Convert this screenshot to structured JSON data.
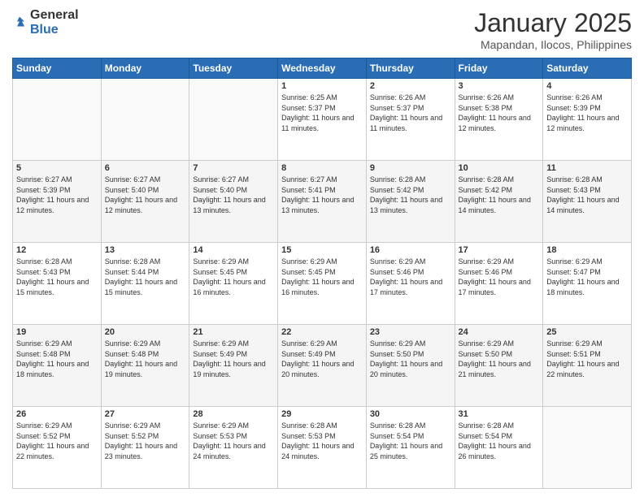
{
  "logo": {
    "general": "General",
    "blue": "Blue"
  },
  "header": {
    "month": "January 2025",
    "location": "Mapandan, Ilocos, Philippines"
  },
  "weekdays": [
    "Sunday",
    "Monday",
    "Tuesday",
    "Wednesday",
    "Thursday",
    "Friday",
    "Saturday"
  ],
  "weeks": [
    [
      {
        "day": "",
        "sunrise": "",
        "sunset": "",
        "daylight": ""
      },
      {
        "day": "",
        "sunrise": "",
        "sunset": "",
        "daylight": ""
      },
      {
        "day": "",
        "sunrise": "",
        "sunset": "",
        "daylight": ""
      },
      {
        "day": "1",
        "sunrise": "Sunrise: 6:25 AM",
        "sunset": "Sunset: 5:37 PM",
        "daylight": "Daylight: 11 hours and 11 minutes."
      },
      {
        "day": "2",
        "sunrise": "Sunrise: 6:26 AM",
        "sunset": "Sunset: 5:37 PM",
        "daylight": "Daylight: 11 hours and 11 minutes."
      },
      {
        "day": "3",
        "sunrise": "Sunrise: 6:26 AM",
        "sunset": "Sunset: 5:38 PM",
        "daylight": "Daylight: 11 hours and 12 minutes."
      },
      {
        "day": "4",
        "sunrise": "Sunrise: 6:26 AM",
        "sunset": "Sunset: 5:39 PM",
        "daylight": "Daylight: 11 hours and 12 minutes."
      }
    ],
    [
      {
        "day": "5",
        "sunrise": "Sunrise: 6:27 AM",
        "sunset": "Sunset: 5:39 PM",
        "daylight": "Daylight: 11 hours and 12 minutes."
      },
      {
        "day": "6",
        "sunrise": "Sunrise: 6:27 AM",
        "sunset": "Sunset: 5:40 PM",
        "daylight": "Daylight: 11 hours and 12 minutes."
      },
      {
        "day": "7",
        "sunrise": "Sunrise: 6:27 AM",
        "sunset": "Sunset: 5:40 PM",
        "daylight": "Daylight: 11 hours and 13 minutes."
      },
      {
        "day": "8",
        "sunrise": "Sunrise: 6:27 AM",
        "sunset": "Sunset: 5:41 PM",
        "daylight": "Daylight: 11 hours and 13 minutes."
      },
      {
        "day": "9",
        "sunrise": "Sunrise: 6:28 AM",
        "sunset": "Sunset: 5:42 PM",
        "daylight": "Daylight: 11 hours and 13 minutes."
      },
      {
        "day": "10",
        "sunrise": "Sunrise: 6:28 AM",
        "sunset": "Sunset: 5:42 PM",
        "daylight": "Daylight: 11 hours and 14 minutes."
      },
      {
        "day": "11",
        "sunrise": "Sunrise: 6:28 AM",
        "sunset": "Sunset: 5:43 PM",
        "daylight": "Daylight: 11 hours and 14 minutes."
      }
    ],
    [
      {
        "day": "12",
        "sunrise": "Sunrise: 6:28 AM",
        "sunset": "Sunset: 5:43 PM",
        "daylight": "Daylight: 11 hours and 15 minutes."
      },
      {
        "day": "13",
        "sunrise": "Sunrise: 6:28 AM",
        "sunset": "Sunset: 5:44 PM",
        "daylight": "Daylight: 11 hours and 15 minutes."
      },
      {
        "day": "14",
        "sunrise": "Sunrise: 6:29 AM",
        "sunset": "Sunset: 5:45 PM",
        "daylight": "Daylight: 11 hours and 16 minutes."
      },
      {
        "day": "15",
        "sunrise": "Sunrise: 6:29 AM",
        "sunset": "Sunset: 5:45 PM",
        "daylight": "Daylight: 11 hours and 16 minutes."
      },
      {
        "day": "16",
        "sunrise": "Sunrise: 6:29 AM",
        "sunset": "Sunset: 5:46 PM",
        "daylight": "Daylight: 11 hours and 17 minutes."
      },
      {
        "day": "17",
        "sunrise": "Sunrise: 6:29 AM",
        "sunset": "Sunset: 5:46 PM",
        "daylight": "Daylight: 11 hours and 17 minutes."
      },
      {
        "day": "18",
        "sunrise": "Sunrise: 6:29 AM",
        "sunset": "Sunset: 5:47 PM",
        "daylight": "Daylight: 11 hours and 18 minutes."
      }
    ],
    [
      {
        "day": "19",
        "sunrise": "Sunrise: 6:29 AM",
        "sunset": "Sunset: 5:48 PM",
        "daylight": "Daylight: 11 hours and 18 minutes."
      },
      {
        "day": "20",
        "sunrise": "Sunrise: 6:29 AM",
        "sunset": "Sunset: 5:48 PM",
        "daylight": "Daylight: 11 hours and 19 minutes."
      },
      {
        "day": "21",
        "sunrise": "Sunrise: 6:29 AM",
        "sunset": "Sunset: 5:49 PM",
        "daylight": "Daylight: 11 hours and 19 minutes."
      },
      {
        "day": "22",
        "sunrise": "Sunrise: 6:29 AM",
        "sunset": "Sunset: 5:49 PM",
        "daylight": "Daylight: 11 hours and 20 minutes."
      },
      {
        "day": "23",
        "sunrise": "Sunrise: 6:29 AM",
        "sunset": "Sunset: 5:50 PM",
        "daylight": "Daylight: 11 hours and 20 minutes."
      },
      {
        "day": "24",
        "sunrise": "Sunrise: 6:29 AM",
        "sunset": "Sunset: 5:50 PM",
        "daylight": "Daylight: 11 hours and 21 minutes."
      },
      {
        "day": "25",
        "sunrise": "Sunrise: 6:29 AM",
        "sunset": "Sunset: 5:51 PM",
        "daylight": "Daylight: 11 hours and 22 minutes."
      }
    ],
    [
      {
        "day": "26",
        "sunrise": "Sunrise: 6:29 AM",
        "sunset": "Sunset: 5:52 PM",
        "daylight": "Daylight: 11 hours and 22 minutes."
      },
      {
        "day": "27",
        "sunrise": "Sunrise: 6:29 AM",
        "sunset": "Sunset: 5:52 PM",
        "daylight": "Daylight: 11 hours and 23 minutes."
      },
      {
        "day": "28",
        "sunrise": "Sunrise: 6:29 AM",
        "sunset": "Sunset: 5:53 PM",
        "daylight": "Daylight: 11 hours and 24 minutes."
      },
      {
        "day": "29",
        "sunrise": "Sunrise: 6:28 AM",
        "sunset": "Sunset: 5:53 PM",
        "daylight": "Daylight: 11 hours and 24 minutes."
      },
      {
        "day": "30",
        "sunrise": "Sunrise: 6:28 AM",
        "sunset": "Sunset: 5:54 PM",
        "daylight": "Daylight: 11 hours and 25 minutes."
      },
      {
        "day": "31",
        "sunrise": "Sunrise: 6:28 AM",
        "sunset": "Sunset: 5:54 PM",
        "daylight": "Daylight: 11 hours and 26 minutes."
      },
      {
        "day": "",
        "sunrise": "",
        "sunset": "",
        "daylight": ""
      }
    ]
  ]
}
